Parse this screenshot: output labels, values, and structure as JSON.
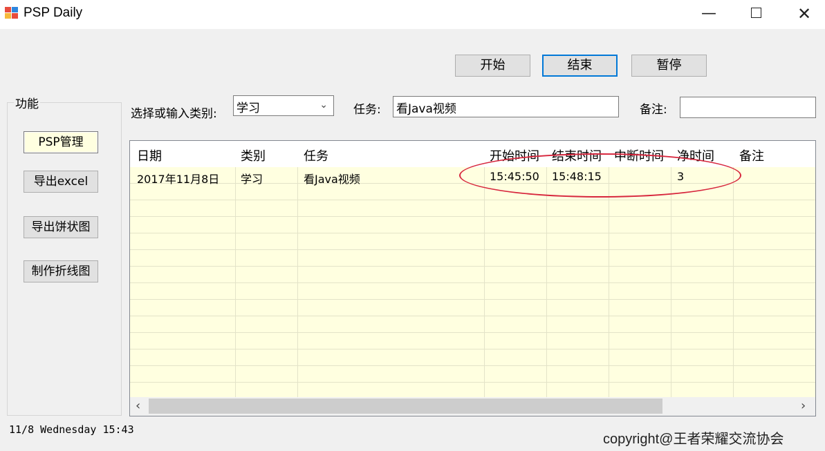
{
  "window": {
    "title": "PSP Daily",
    "icon": "app-icon",
    "controls": {
      "minimize": "—",
      "close": "✕"
    }
  },
  "toolbar": {
    "start_label": "开始",
    "end_label": "结束",
    "pause_label": "暂停"
  },
  "sidebar": {
    "group_label": "功能",
    "items": [
      {
        "label": "PSP管理",
        "active": true
      },
      {
        "label": "导出excel",
        "active": false
      },
      {
        "label": "导出饼状图",
        "active": false
      },
      {
        "label": "制作折线图",
        "active": false
      }
    ]
  },
  "form": {
    "category_label": "选择或输入类别:",
    "category_value": "学习",
    "task_label": "任务:",
    "task_value": "看Java视频",
    "note_label": "备注:",
    "note_value": ""
  },
  "table": {
    "columns": [
      "日期",
      "类别",
      "任务",
      "开始时间",
      "结束时间",
      "中断时间",
      "净时间",
      "备注"
    ],
    "rows": [
      [
        "2017年11月8日",
        "学习",
        "看Java视频",
        "15:45:50",
        "15:48:15",
        "",
        "3",
        ""
      ]
    ],
    "scroll_left": "‹",
    "scroll_right": "›"
  },
  "status": {
    "datetime": "11/8  Wednesday 15:43"
  },
  "footer": {
    "copyright": "copyright@王者荣耀交流协会"
  },
  "colors": {
    "grid_body": "#ffffe0",
    "primary_border": "#0078d7",
    "annotation": "#d7263d"
  }
}
